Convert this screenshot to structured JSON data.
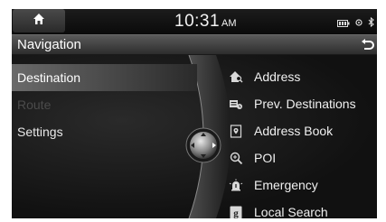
{
  "status": {
    "time": "10:31",
    "ampm": "AM"
  },
  "header": {
    "title": "Navigation"
  },
  "left_menu": {
    "items": [
      {
        "label": "Destination",
        "state": "selected"
      },
      {
        "label": "Route",
        "state": "disabled"
      },
      {
        "label": "Settings",
        "state": "normal"
      }
    ]
  },
  "right_menu": {
    "items": [
      {
        "label": "Address",
        "icon": "house-search-icon"
      },
      {
        "label": "Prev. Destinations",
        "icon": "history-flag-icon"
      },
      {
        "label": "Address Book",
        "icon": "address-book-icon"
      },
      {
        "label": "POI",
        "icon": "poi-search-icon"
      },
      {
        "label": "Emergency",
        "icon": "emergency-icon"
      },
      {
        "label": "Local Search",
        "icon": "google-icon"
      }
    ]
  },
  "colors": {
    "background": "#0d0d0d",
    "selected": "#6a6a6a",
    "text": "#f0f0f0",
    "disabled": "#4b4b4b"
  }
}
